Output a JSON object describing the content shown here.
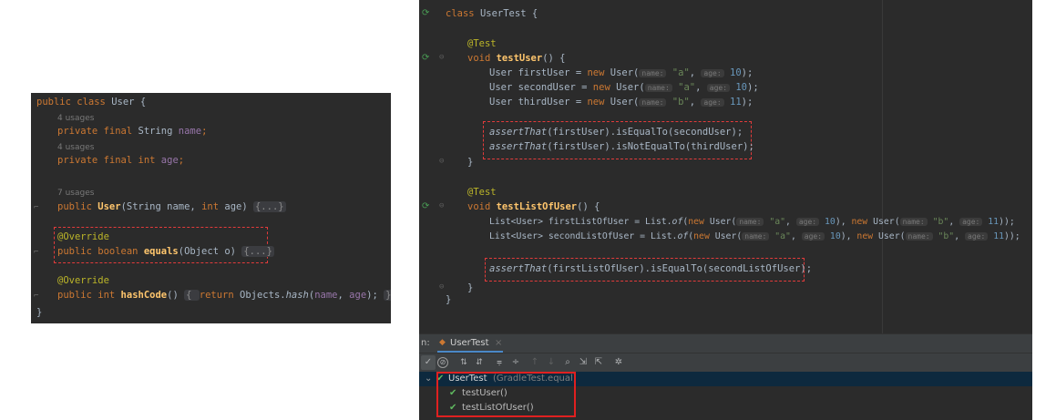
{
  "left_editor": {
    "class_decl": {
      "kw1": "public ",
      "kw2": "class ",
      "name": "User",
      "brace": " {"
    },
    "usages_4": "4 usages",
    "field_name": {
      "kw": "private final ",
      "type": "String ",
      "name": "name",
      "semi": ";"
    },
    "usages_4b": "4 usages",
    "field_age": {
      "kw": "private final int ",
      "name": "age",
      "semi": ";"
    },
    "usages_7": "7 usages",
    "ctor": {
      "kw": "public ",
      "name": "User",
      "args_a": "(String name, ",
      "int_kw": "int ",
      "args_b": "age) ",
      "fold": "{...}"
    },
    "equals_ann": "@Override",
    "equals_sig": {
      "kw": "public boolean ",
      "name": "equals",
      "args": "(Object o) ",
      "fold": "{...}"
    },
    "hash_ann": "@Override",
    "hash_sig": {
      "kw": "public int ",
      "name": "hashCode",
      "args": "() ",
      "open": "{ ",
      "ret": "return ",
      "obj": "Objects.",
      "method": "hash",
      "p1": "(",
      "a1": "name",
      "comma": ", ",
      "a2": "age",
      "p2": "); ",
      "close": "}"
    },
    "closing": "}"
  },
  "right_editor": {
    "class_decl": {
      "kw": "class ",
      "name": "UserTest",
      "brace": " {"
    },
    "test1": {
      "ann": "@Test",
      "sig": {
        "kw": "void ",
        "name": "testUser",
        "rest": "() {"
      },
      "l1": {
        "decl": "User firstUser = ",
        "new_kw": "new ",
        "type": "User(",
        "h1": "name:",
        "s1": "\"a\"",
        "c": ", ",
        "h2": "age:",
        "n": "10",
        "end": ");"
      },
      "l2": {
        "decl": "User secondUser = ",
        "new_kw": "new ",
        "type": "User(",
        "h1": "name:",
        "s1": "\"a\"",
        "c": ", ",
        "h2": "age:",
        "n": "10",
        "end": ");"
      },
      "l3": {
        "decl": "User thirdUser = ",
        "new_kw": "new ",
        "type": "User(",
        "h1": "name:",
        "s1": "\"b\"",
        "c": ", ",
        "h2": "age:",
        "n": "11",
        "end": ");"
      },
      "a1": {
        "fn": "assertThat",
        "rest": "(firstUser).isEqualTo(secondUser);"
      },
      "a2": {
        "fn": "assertThat",
        "rest": "(firstUser).isNotEqualTo(thirdUser);"
      },
      "close": "}"
    },
    "test2": {
      "ann": "@Test",
      "sig": {
        "kw": "void ",
        "name": "testListOfUser",
        "rest": "() {"
      },
      "l1": {
        "decl": "List<User> firstListOfUser = List.",
        "of": "of",
        "p": "(",
        "new1": "new ",
        "t1": "User(",
        "h1": "name:",
        "s1": "\"a\"",
        "c1": ", ",
        "h2": "age:",
        "n1": "10",
        "m": "), ",
        "new2": "new ",
        "t2": "User(",
        "h3": "name:",
        "s2": "\"b\"",
        "c2": ", ",
        "h4": "age:",
        "n2": "11",
        "end": "));"
      },
      "l2": {
        "decl": "List<User> secondListOfUser = List.",
        "of": "of",
        "p": "(",
        "new1": "new ",
        "t1": "User(",
        "h1": "name:",
        "s1": "\"a\"",
        "c1": ", ",
        "h2": "age:",
        "n1": "10",
        "m": "), ",
        "new2": "new ",
        "t2": "User(",
        "h3": "name:",
        "s2": "\"b\"",
        "c2": ", ",
        "h4": "age:",
        "n2": "11",
        "end": "));"
      },
      "a1": {
        "fn": "assertThat",
        "rest": "(firstListOfUser).isEqualTo(secondListOfUser);"
      },
      "close": "}"
    },
    "closing": "}"
  },
  "run_panel": {
    "prefix": "n:",
    "tab_label": "UserTest",
    "tab_close": "×",
    "tree": {
      "root_label": "UserTest",
      "root_detail": "(GradleTest.equal)",
      "child1": "testUser()",
      "child2": "testListOfUser()"
    }
  },
  "colors": {
    "editor_bg": "#2b2b2b",
    "keyword": "#cc7832",
    "field": "#9876aa",
    "method": "#ffc66d",
    "string": "#6a8759",
    "number": "#6897bb",
    "annotation": "#bbb529",
    "highlight_box": "#e02020",
    "pass_green": "#5fb85f"
  }
}
